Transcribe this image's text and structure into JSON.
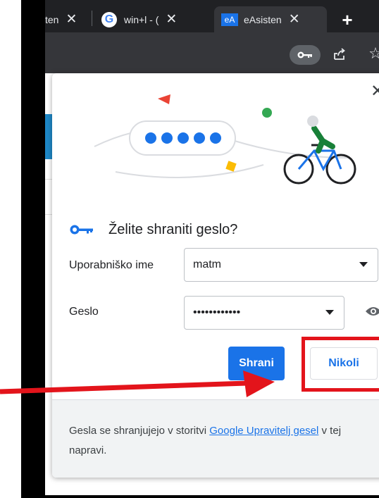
{
  "tabs": [
    {
      "label": "ten",
      "close": "✕"
    },
    {
      "label": "win+l - (",
      "close": "✕",
      "icon_letter": "G"
    },
    {
      "label": "eAsisten",
      "close": "✕",
      "icon_letter": "eA"
    }
  ],
  "new_tab": "+",
  "toolbar": {
    "key_icon": "key-icon",
    "share_icon": "share-icon",
    "star_icon": "star-icon"
  },
  "dialog": {
    "title": "Želite shraniti geslo?",
    "close": "✕",
    "username_label": "Uporabniško ime",
    "username_value": "matm",
    "password_label": "Geslo",
    "password_value": "••••••••••••",
    "save_label": "Shrani",
    "never_label": "Nikoli",
    "footer_text": "Gesla se shranjujejo v storitvi ",
    "footer_link": "Google Upravitelj gesel",
    "footer_text_end": " v tej napravi."
  },
  "colors": {
    "accent": "#1a73e8",
    "highlight": "#e3141b",
    "arrow": "#e3141b"
  }
}
